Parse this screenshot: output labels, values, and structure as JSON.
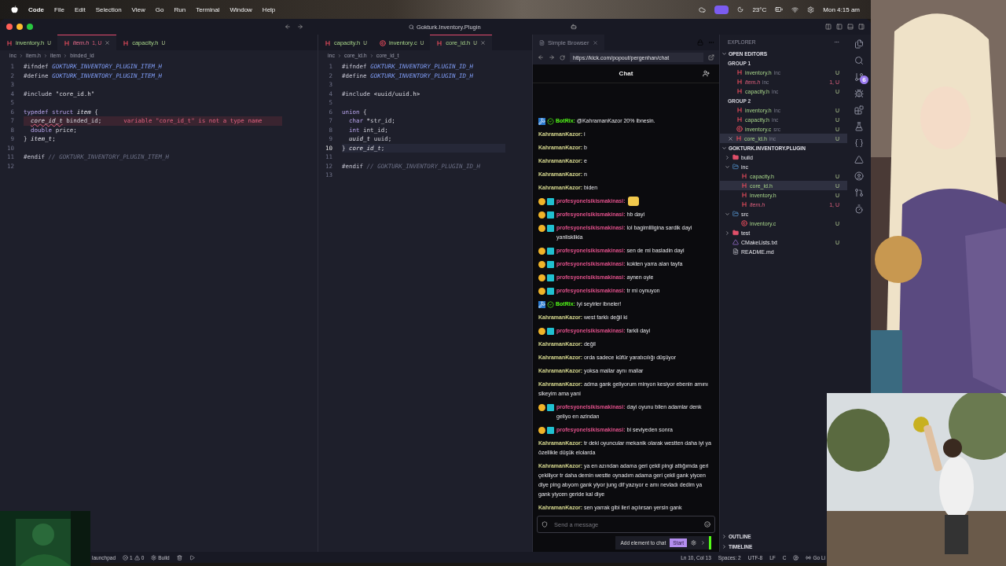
{
  "menu_bar": {
    "app": "Code",
    "items": [
      "File",
      "Edit",
      "Selection",
      "View",
      "Go",
      "Run",
      "Terminal",
      "Window",
      "Help"
    ],
    "temperature": "23°C",
    "clock": "Mon 4:15 am"
  },
  "window": {
    "title": "Gokturk.Inventory.Plugin"
  },
  "editor_groups": [
    {
      "tabs": [
        {
          "label": "inventory.h",
          "badge": "U",
          "kind": "h",
          "selected": false,
          "error": false
        },
        {
          "label": "item.h",
          "badge": "1, U",
          "kind": "h",
          "selected": true,
          "error": true
        },
        {
          "label": "capacity.h",
          "badge": "U",
          "kind": "h",
          "selected": false,
          "error": false
        }
      ],
      "breadcrumbs": [
        "inc",
        "item.h",
        "item",
        "binded_id"
      ],
      "lines": [
        {
          "number": "1",
          "current": false,
          "tokens": [
            {
              "kind": "macro",
              "text": "#ifndef "
            },
            {
              "kind": "const",
              "text": "GOKTURK_INVENTORY_PLUGIN_ITEM_H"
            }
          ]
        },
        {
          "number": "2",
          "current": false,
          "tokens": [
            {
              "kind": "macro",
              "text": "#define "
            },
            {
              "kind": "const",
              "text": "GOKTURK_INVENTORY_PLUGIN_ITEM_H"
            }
          ]
        },
        {
          "number": "3",
          "current": false
        },
        {
          "number": "4",
          "current": false,
          "tokens": [
            {
              "kind": "macro",
              "text": "#include "
            },
            {
              "kind": "string",
              "text": "\"core_id.h\""
            }
          ]
        },
        {
          "number": "5",
          "current": false
        },
        {
          "number": "6",
          "current": false,
          "tokens": [
            {
              "kind": "keyword",
              "text": "typedef struct "
            },
            {
              "kind": "type",
              "text": "item"
            },
            {
              "kind": "plain",
              "text": " {"
            }
          ]
        },
        {
          "number": "7",
          "current": false,
          "tokens": [
            {
              "kind": "error_type",
              "text": "  core_id_t"
            },
            {
              "kind": "plain",
              "text": " binded_id;"
            }
          ],
          "error_message": "variable \"core_id_t\" is not a type name"
        },
        {
          "number": "8",
          "current": false,
          "tokens": [
            {
              "kind": "keyword",
              "text": "  double"
            },
            {
              "kind": "plain",
              "text": " price;"
            }
          ]
        },
        {
          "number": "9",
          "current": false,
          "tokens": [
            {
              "kind": "plain",
              "text": "} "
            },
            {
              "kind": "type",
              "text": "item_t"
            },
            {
              "kind": "plain",
              "text": ";"
            }
          ]
        },
        {
          "number": "10",
          "current": false
        },
        {
          "number": "11",
          "current": false,
          "tokens": [
            {
              "kind": "macro",
              "text": "#endif"
            },
            {
              "kind": "comment",
              "text": " // GOKTURK_INVENTORY_PLUGIN_ITEM_H"
            }
          ]
        },
        {
          "number": "12",
          "current": false
        }
      ]
    },
    {
      "tabs": [
        {
          "label": "capacity.h",
          "badge": "U",
          "kind": "h",
          "selected": false,
          "error": false
        },
        {
          "label": "inventory.c",
          "badge": "U",
          "kind": "c",
          "selected": false,
          "error": false
        },
        {
          "label": "core_id.h",
          "badge": "U",
          "kind": "h",
          "selected": true,
          "error": false
        }
      ],
      "breadcrumbs": [
        "inc",
        "core_id.h",
        "core_id_t"
      ],
      "lines": [
        {
          "number": "1",
          "current": false,
          "tokens": [
            {
              "kind": "macro",
              "text": "#ifndef "
            },
            {
              "kind": "const",
              "text": "GOKTURK_INVENTORY_PLUGIN_ID_H"
            }
          ]
        },
        {
          "number": "2",
          "current": false,
          "tokens": [
            {
              "kind": "macro",
              "text": "#define "
            },
            {
              "kind": "const",
              "text": "GOKTURK_INVENTORY_PLUGIN_ID_H"
            }
          ]
        },
        {
          "number": "3",
          "current": false
        },
        {
          "number": "4",
          "current": false,
          "tokens": [
            {
              "kind": "macro",
              "text": "#include "
            },
            {
              "kind": "string",
              "text": "<uuid/uuid.h>"
            }
          ]
        },
        {
          "number": "5",
          "current": false
        },
        {
          "number": "6",
          "current": false,
          "tokens": [
            {
              "kind": "keyword",
              "text": "union"
            },
            {
              "kind": "plain",
              "text": " {"
            }
          ]
        },
        {
          "number": "7",
          "current": false,
          "tokens": [
            {
              "kind": "keyword",
              "text": "  char"
            },
            {
              "kind": "plain",
              "text": " *str_id;"
            }
          ]
        },
        {
          "number": "8",
          "current": false,
          "tokens": [
            {
              "kind": "keyword",
              "text": "  int"
            },
            {
              "kind": "plain",
              "text": " int_id;"
            }
          ]
        },
        {
          "number": "9",
          "current": false,
          "tokens": [
            {
              "kind": "type",
              "text": "  uuid_t"
            },
            {
              "kind": "plain",
              "text": " uuid;"
            }
          ]
        },
        {
          "number": "10",
          "current": true,
          "tokens": [
            {
              "kind": "plain",
              "text": "} "
            },
            {
              "kind": "type",
              "text": "core_id_t"
            },
            {
              "kind": "plain",
              "text": ";"
            }
          ]
        },
        {
          "number": "11",
          "current": false
        },
        {
          "number": "12",
          "current": false,
          "tokens": [
            {
              "kind": "macro",
              "text": "#endif"
            },
            {
              "kind": "comment",
              "text": " // GOKTURK_INVENTORY_PLUGIN_ID_H"
            }
          ]
        },
        {
          "number": "13",
          "current": false
        }
      ]
    }
  ],
  "browser": {
    "tab": "Simple Browser",
    "url": "https://kick.com/popout/pergenhan/chat",
    "chat": {
      "title": "Chat",
      "messages": [
        {
          "kind": "bot",
          "user": "BotRix:",
          "color": "#53fc18",
          "text": "@KahramanKazor 20% ibnesin.",
          "emote": false
        },
        {
          "kind": "plain",
          "user": "KahramanKazor:",
          "color": "#d5d78e",
          "text": "i",
          "emote": false
        },
        {
          "kind": "plain",
          "user": "KahramanKazor:",
          "color": "#d5d78e",
          "text": "b",
          "emote": false
        },
        {
          "kind": "plain",
          "user": "KahramanKazor:",
          "color": "#d5d78e",
          "text": "e",
          "emote": false
        },
        {
          "kind": "plain",
          "user": "KahramanKazor:",
          "color": "#d5d78e",
          "text": "n",
          "emote": false
        },
        {
          "kind": "plain",
          "user": "KahramanKazor:",
          "color": "#d5d78e",
          "text": "biden",
          "emote": false
        },
        {
          "kind": "sub",
          "user": "profesyonelsikismakinasi:",
          "color": "#e0508a",
          "emote": true
        },
        {
          "kind": "sub",
          "user": "profesyonelsikismakinasi:",
          "color": "#e0508a",
          "text": "hb dayi",
          "emote": false
        },
        {
          "kind": "sub",
          "user": "profesyonelsikismakinasi:",
          "color": "#e0508a",
          "text": "lol bagimliligina sardik dayi yanlisklikla",
          "emote": false
        },
        {
          "kind": "sub",
          "user": "profesyonelsikismakinasi:",
          "color": "#e0508a",
          "text": "sen de mi basladin dayi",
          "emote": false
        },
        {
          "kind": "sub",
          "user": "profesyonelsikismakinasi:",
          "color": "#e0508a",
          "text": "kokten yarra alan tayfa",
          "emote": false
        },
        {
          "kind": "sub",
          "user": "profesyonelsikismakinasi:",
          "color": "#e0508a",
          "text": "aynen oyle",
          "emote": false
        },
        {
          "kind": "sub",
          "user": "profesyonelsikismakinasi:",
          "color": "#e0508a",
          "text": "tr mi oynuyon",
          "emote": false
        },
        {
          "kind": "bot",
          "user": "BotRix:",
          "color": "#53fc18",
          "text": "Iyi seyirler ibneler!",
          "emote": false
        },
        {
          "kind": "plain",
          "user": "KahramanKazor:",
          "color": "#d5d78e",
          "text": "west farklı değil ki",
          "emote": false
        },
        {
          "kind": "sub",
          "user": "profesyonelsikismakinasi:",
          "color": "#e0508a",
          "text": "farkli dayi",
          "emote": false
        },
        {
          "kind": "plain",
          "user": "KahramanKazor:",
          "color": "#d5d78e",
          "text": "değil",
          "emote": false
        },
        {
          "kind": "plain",
          "user": "KahramanKazor:",
          "color": "#d5d78e",
          "text": "orda sadece küfür yaratıcılığı düşüyor",
          "emote": false
        },
        {
          "kind": "plain",
          "user": "KahramanKazor:",
          "color": "#d5d78e",
          "text": "yoksa mallar aynı mallar",
          "emote": false
        },
        {
          "kind": "plain",
          "user": "KahramanKazor:",
          "color": "#d5d78e",
          "text": "adma gank geliyorum minyon kesiyor ebenin amını sikeyim ama yani",
          "emote": false
        },
        {
          "kind": "sub",
          "user": "profesyonelsikismakinasi:",
          "color": "#e0508a",
          "text": "dayi oyunu bilen adamlar denk geliyo en azindan",
          "emote": false
        },
        {
          "kind": "sub",
          "user": "profesyonelsikismakinasi:",
          "color": "#e0508a",
          "text": "bi seviyeden sonra",
          "emote": false
        },
        {
          "kind": "plain",
          "user": "KahramanKazor:",
          "color": "#d5d78e",
          "text": "tr deki oyuncular mekanik olarak westten daha iyi ya özellikle düşük elolarda",
          "emote": false
        },
        {
          "kind": "plain",
          "user": "KahramanKazor:",
          "color": "#d5d78e",
          "text": "ya en azından adama geri çekil pingi attığımda geri çekiliyor tr daha demin westte oynadım adama geri çekil gank yiycen diye ping atıyom gank yiyor jung dif yazıyor e amı nevladı dedim ya gank yiycen geride kal diye",
          "emote": false
        },
        {
          "kind": "plain",
          "user": "KahramanKazor:",
          "color": "#d5d78e",
          "text": "sen yarrak gibi ileri açılırsan yersin gank",
          "emote": false
        }
      ],
      "input": {
        "placeholder": "Send a message"
      },
      "popup": {
        "label": "Add element to chat",
        "button": "Start"
      }
    }
  },
  "explorer": {
    "title": "EXPLORER",
    "open_editors": {
      "title": "OPEN EDITORS",
      "expanded": true,
      "groups": [
        {
          "title": "GROUP 1",
          "files": [
            {
              "label": "inventory.h",
              "folder": "inc",
              "badge": "U",
              "kind": "h",
              "error": false,
              "selected": false
            },
            {
              "label": "item.h",
              "folder": "inc",
              "badge": "1, U",
              "kind": "h",
              "error": true,
              "selected": false
            },
            {
              "label": "capacity.h",
              "folder": "inc",
              "badge": "U",
              "kind": "h",
              "error": false,
              "selected": false
            }
          ]
        },
        {
          "title": "GROUP 2",
          "files": [
            {
              "label": "inventory.h",
              "folder": "inc",
              "badge": "U",
              "kind": "h",
              "error": false,
              "selected": false
            },
            {
              "label": "capacity.h",
              "folder": "inc",
              "badge": "U",
              "kind": "h",
              "error": false,
              "selected": false
            },
            {
              "label": "inventory.c",
              "folder": "src",
              "badge": "U",
              "kind": "c",
              "error": false,
              "selected": false
            },
            {
              "label": "core_id.h",
              "folder": "inc",
              "badge": "U",
              "kind": "h",
              "error": false,
              "selected": true
            }
          ]
        }
      ]
    },
    "project": {
      "title": "GOKTURK.INVENTORY.PLUGIN",
      "expanded": true,
      "tree": [
        {
          "label": "build",
          "kind": "folder",
          "expanded": false,
          "selected": false,
          "error": false
        },
        {
          "label": "inc",
          "kind": "folder",
          "expanded": true,
          "selected": false,
          "error": false,
          "children": [
            {
              "label": "capacity.h",
              "kind": "h",
              "badge": "U",
              "selected": false,
              "error": false
            },
            {
              "label": "core_id.h",
              "kind": "h",
              "badge": "U",
              "selected": true,
              "error": false
            },
            {
              "label": "inventory.h",
              "kind": "h",
              "badge": "U",
              "selected": false,
              "error": false
            },
            {
              "label": "item.h",
              "kind": "h",
              "badge": "1, U",
              "selected": false,
              "error": true
            }
          ]
        },
        {
          "label": "src",
          "kind": "folder",
          "expanded": true,
          "selected": false,
          "error": false,
          "children": [
            {
              "label": "inventory.c",
              "kind": "c",
              "badge": "U",
              "selected": false,
              "error": false
            }
          ]
        },
        {
          "label": "test",
          "kind": "folder",
          "expanded": false,
          "selected": false,
          "error": false
        },
        {
          "label": "CMakeLists.txt",
          "kind": "cmake",
          "badge": "U",
          "selected": false,
          "error": false
        },
        {
          "label": "README.md",
          "kind": "md",
          "selected": false,
          "error": false
        }
      ]
    },
    "sections": [
      "OUTLINE",
      "TIMELINE"
    ]
  },
  "activity_bar": {
    "source_control_badge": "6"
  },
  "status_bar": {
    "launchpad": "launchpad",
    "errors": "1",
    "warnings": "0",
    "build": "Build",
    "position": "Ln 10, Col 13",
    "indent": "Spaces: 2",
    "encoding": "UTF-8",
    "eol": "LF",
    "language": "C",
    "live": "Go Li"
  }
}
